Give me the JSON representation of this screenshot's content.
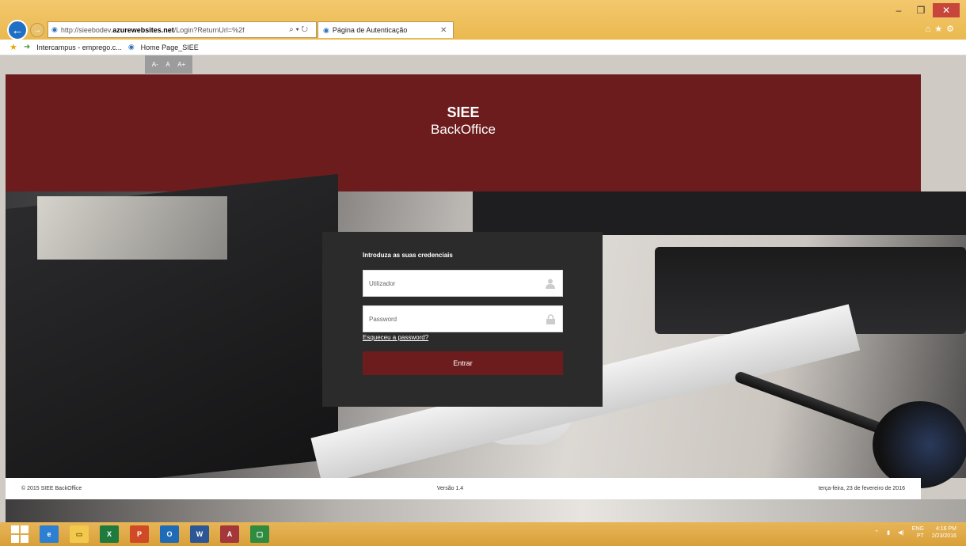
{
  "browser": {
    "url_prefix": "http://sieebodev.",
    "url_domain": "azurewebsites.net",
    "url_path": "/Login?ReturnUrl=%2f",
    "tab_title": "Página de Autenticação",
    "favorites": [
      "Intercampus - emprego.c...",
      "Home Page_SIEE"
    ]
  },
  "page": {
    "font_sizer": [
      "A-",
      "A",
      "A+"
    ],
    "banner_title": "SIEE",
    "banner_subtitle": "BackOffice",
    "login": {
      "heading": "Introduza as suas credenciais",
      "username_placeholder": "Utilizador",
      "password_placeholder": "Password",
      "forgot_link": "Esqueceu a password?",
      "submit_label": "Entrar"
    },
    "footer": {
      "copyright": "© 2015 SIEE BackOffice",
      "version": "Versão 1.4",
      "date": "terça-feira, 23 de fevereiro de 2016"
    }
  },
  "taskbar": {
    "apps": [
      "ie-icon",
      "explorer-icon",
      "excel-icon",
      "powerpoint-icon",
      "outlook-icon",
      "word-icon",
      "access-icon",
      "project-icon"
    ],
    "language": "ENG",
    "region": "PT",
    "time": "4:16 PM",
    "date": "2/23/2016"
  },
  "colors": {
    "brand_red": "#6d1c1d",
    "login_bg": "#2b2b2b",
    "chrome_gold": "#eab94f"
  }
}
